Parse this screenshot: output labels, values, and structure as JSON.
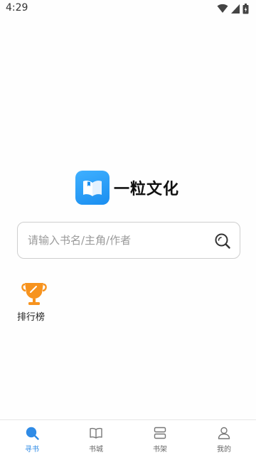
{
  "status_bar": {
    "time": "4:29",
    "icons": [
      "wifi-icon",
      "signal-icon",
      "battery-icon"
    ]
  },
  "app": {
    "name": "一粒文化",
    "brand_color": "#2196f3"
  },
  "search": {
    "placeholder": "请输入书名/主角/作者",
    "icon": "search-icon"
  },
  "ranking": {
    "label": "排行榜",
    "icon": "trophy-icon",
    "color": "#f7931e"
  },
  "bottom_nav": {
    "active_color": "#2f8be6",
    "items": [
      {
        "label": "寻书",
        "icon": "search-icon",
        "active": true
      },
      {
        "label": "书城",
        "icon": "book-open-icon",
        "active": false
      },
      {
        "label": "书架",
        "icon": "bookshelf-icon",
        "active": false
      },
      {
        "label": "我的",
        "icon": "user-icon",
        "active": false
      }
    ]
  }
}
